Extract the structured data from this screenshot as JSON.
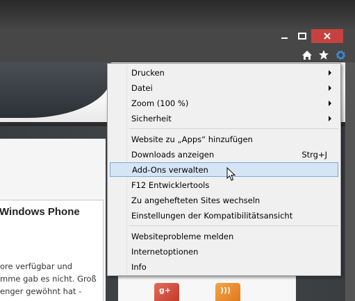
{
  "window": {
    "caption": {
      "minimize_icon": "minimize-icon",
      "maximize_icon": "maximize-icon",
      "close_icon": "close-icon",
      "close_color": "#c7423f"
    },
    "toolbar_icons": [
      "home-icon",
      "favorites-star-icon",
      "tools-gear-icon"
    ],
    "gear_color": "#3a8fd6"
  },
  "page": {
    "news_title": "Windows Phone",
    "news_lines": [
      "ore verfügbar und",
      "mme gab es nicht. Groß",
      "enger gewöhnt hat -"
    ]
  },
  "menu": {
    "groups": [
      [
        {
          "label": "Drucken",
          "submenu": true
        },
        {
          "label": "Datei",
          "submenu": true
        },
        {
          "label": "Zoom (100 %)",
          "submenu": true
        },
        {
          "label": "Sicherheit",
          "submenu": true
        }
      ],
      [
        {
          "label": "Website zu „Apps“ hinzufügen"
        },
        {
          "label": "Downloads anzeigen",
          "shortcut": "Strg+J"
        },
        {
          "label": "Add-Ons verwalten",
          "highlighted": true
        },
        {
          "label": "F12 Entwicklertools"
        },
        {
          "label": "Zu angehefteten Sites wechseln"
        },
        {
          "label": "Einstellungen der Kompatibilitätsansicht"
        }
      ],
      [
        {
          "label": "Websiteprobleme melden"
        },
        {
          "label": "Internetoptionen"
        },
        {
          "label": "Info"
        }
      ]
    ],
    "highlight_color": "#d5e5f6"
  }
}
